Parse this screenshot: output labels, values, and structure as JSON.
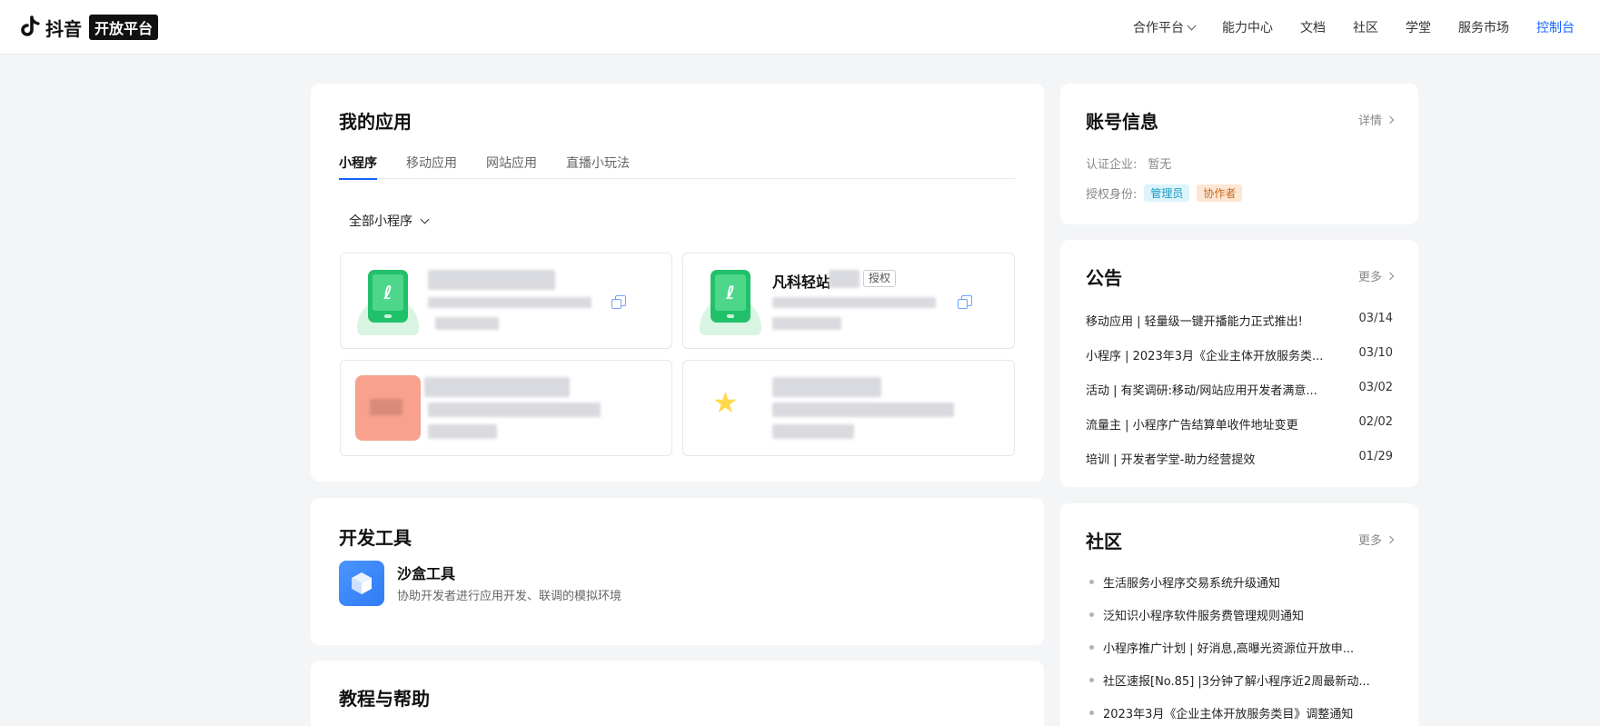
{
  "header": {
    "logo_text": "抖音",
    "logo_badge": "开放平台",
    "nav": [
      {
        "label": "合作平台",
        "dropdown": true
      },
      {
        "label": "能力中心"
      },
      {
        "label": "文档"
      },
      {
        "label": "社区"
      },
      {
        "label": "学堂"
      },
      {
        "label": "服务市场"
      },
      {
        "label": "控制台",
        "active": true
      }
    ]
  },
  "my_apps": {
    "title": "我的应用",
    "tabs": [
      "小程序",
      "移动应用",
      "网站应用",
      "直播小玩法"
    ],
    "active_tab": "小程序",
    "filter_label": "全部小程序",
    "apps": [
      {
        "icon": "mini-program-icon",
        "name": "",
        "badge": ""
      },
      {
        "icon": "mini-program-icon",
        "name": "凡科轻站",
        "badge": "授权"
      },
      {
        "icon": "orange-app-icon",
        "name": "",
        "badge": ""
      },
      {
        "icon": "star-icon",
        "name": "",
        "badge": ""
      }
    ]
  },
  "dev_tools": {
    "title": "开发工具",
    "tool_name": "沙盒工具",
    "tool_desc": "协助开发者进行应用开发、联调的模拟环境"
  },
  "tutorials": {
    "title": "教程与帮助"
  },
  "account": {
    "title": "账号信息",
    "detail_link": "详情",
    "cert_label": "认证企业:",
    "cert_value": "暂无",
    "role_label": "授权身份:",
    "roles": [
      "管理员",
      "协作者"
    ]
  },
  "announcements": {
    "title": "公告",
    "more": "更多",
    "items": [
      {
        "text": "移动应用 | 轻量级一键开播能力正式推出!",
        "date": "03/14"
      },
      {
        "text": "小程序 | 2023年3月《企业主体开放服务类...",
        "date": "03/10"
      },
      {
        "text": "活动 | 有奖调研:移动/网站应用开发者满意...",
        "date": "03/02"
      },
      {
        "text": "流量主 | 小程序广告结算单收件地址变更",
        "date": "02/02"
      },
      {
        "text": "培训 | 开发者学堂-助力经营提效",
        "date": "01/29"
      }
    ]
  },
  "community": {
    "title": "社区",
    "more": "更多",
    "items": [
      "生活服务小程序交易系统升级通知",
      "泛知识小程序软件服务费管理规则通知",
      "小程序推广计划 | 好消息,高曝光资源位开放申...",
      "社区速报[No.85] |3分钟了解小程序近2周最新动...",
      "2023年3月《企业主体开放服务类目》调整通知"
    ]
  },
  "colors": {
    "accent": "#1664ff",
    "mini_program_green": "#21c16b",
    "app_orange": "#f7a18e"
  }
}
